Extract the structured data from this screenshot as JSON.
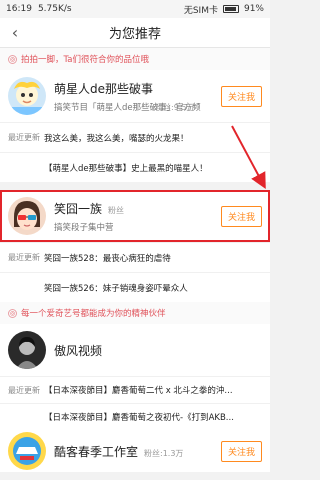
{
  "status": {
    "time": "16:19",
    "speed": "5.75K/s",
    "carrier": "无SIM卡",
    "battery": "91%"
  },
  "nav": {
    "back_icon": "‹",
    "title": "为您推荐"
  },
  "sections": [
    {
      "hint": "拍拍一脚，Ta们很符合你的品位哦"
    },
    {
      "hint": "每一个爱奇艺号都能成为你的精神伙伴"
    }
  ],
  "accounts": [
    {
      "name": "萌星人de那些破事",
      "fans": "粉丝:9.5万",
      "desc": "搞笑节目「萌星人de那些破事」官方频",
      "follow": "关注我",
      "updates": [
        {
          "label": "最近更新",
          "text": "我这么美，我这么美，嘴瑟的火龙果！"
        },
        {
          "label": "",
          "text": "【萌星人de那些破事】史上最黑的喵星人！"
        }
      ]
    },
    {
      "name": "笑囧一族",
      "fans": "粉丝",
      "desc": "搞笑段子集中营",
      "follow": "关注我",
      "updates": [
        {
          "label": "最近更新",
          "text": "笑囧一族528：最丧心病狂的虐待"
        },
        {
          "label": "",
          "text": "笑囧一族526：妹子销魂身姿吓晕众人"
        }
      ]
    },
    {
      "name": "傲风视频",
      "fans": "",
      "desc": "",
      "follow": "",
      "updates": [
        {
          "label": "最近更新",
          "text": "【日本深夜節目】麝香葡萄二代 x 北斗之拳的沖..."
        },
        {
          "label": "",
          "text": "【日本深夜節目】麝香葡萄之夜初代-《打到AKB..."
        }
      ]
    },
    {
      "name": "酷客春季工作室",
      "fans": "粉丝:1.3万",
      "desc": "",
      "follow": "关注我",
      "updates": []
    }
  ],
  "colors": {
    "accent": "#ff8a1f",
    "highlight": "#e2252b",
    "hint": "#e0525a"
  }
}
